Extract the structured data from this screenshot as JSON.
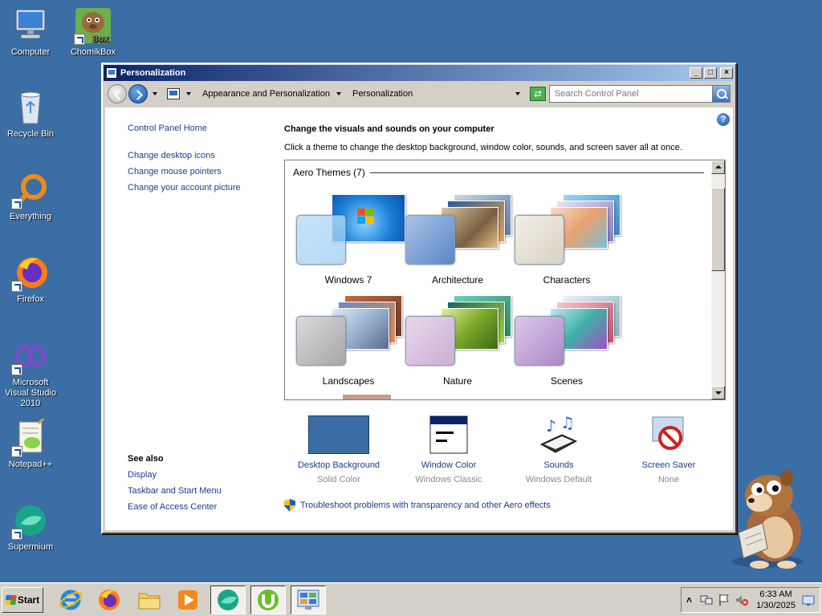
{
  "desktop": {
    "icons": [
      {
        "label": "Computer"
      },
      {
        "label": "ChomikBox",
        "overlay": "Box"
      },
      {
        "label": "Recycle Bin"
      },
      {
        "label": "Everything"
      },
      {
        "label": "Firefox"
      },
      {
        "label": "Microsoft Visual Studio 2010"
      },
      {
        "label": "Notepad++"
      },
      {
        "label": "Supermium"
      }
    ]
  },
  "window": {
    "title": "Personalization",
    "controls": {
      "minimize": "_",
      "maximize": "□",
      "close": "×"
    },
    "address": {
      "crumbs": [
        "Appearance and Personalization",
        "Personalization"
      ],
      "search_placeholder": "Search Control Panel"
    },
    "help_label": "?",
    "left_pane": {
      "home": "Control Panel Home",
      "links": [
        "Change desktop icons",
        "Change mouse pointers",
        "Change your account picture"
      ],
      "see_also_title": "See also",
      "see_also": [
        "Display",
        "Taskbar and Start Menu",
        "Ease of Access Center"
      ]
    },
    "main": {
      "title": "Change the visuals and sounds on your computer",
      "description": "Click a theme to change the desktop background, window color, sounds, and screen saver all at once.",
      "group_header": "Aero Themes (7)",
      "themes": [
        {
          "name": "Windows 7"
        },
        {
          "name": "Architecture"
        },
        {
          "name": "Characters"
        },
        {
          "name": "Landscapes"
        },
        {
          "name": "Nature"
        },
        {
          "name": "Scenes"
        }
      ],
      "settings": [
        {
          "label": "Desktop Background",
          "value": "Solid Color"
        },
        {
          "label": "Window Color",
          "value": "Windows Classic"
        },
        {
          "label": "Sounds",
          "value": "Windows Default"
        },
        {
          "label": "Screen Saver",
          "value": "None"
        }
      ],
      "troubleshoot": "Troubleshoot problems with transparency and other Aero effects"
    }
  },
  "taskbar": {
    "start_label": "Start",
    "apps": [
      "internet-explorer",
      "firefox",
      "file-explorer",
      "media-player",
      "supermium",
      "utorrent",
      "control-panel"
    ],
    "clock": {
      "time": "6:33 AM",
      "date": "1/30/2025"
    }
  },
  "colors": {
    "desktop": "#3a6ea5",
    "titlebar_start": "#0a246a",
    "titlebar_end": "#a6caf0",
    "link": "#1e3c8c",
    "solid_color_swatch": "#3a6ea5"
  }
}
